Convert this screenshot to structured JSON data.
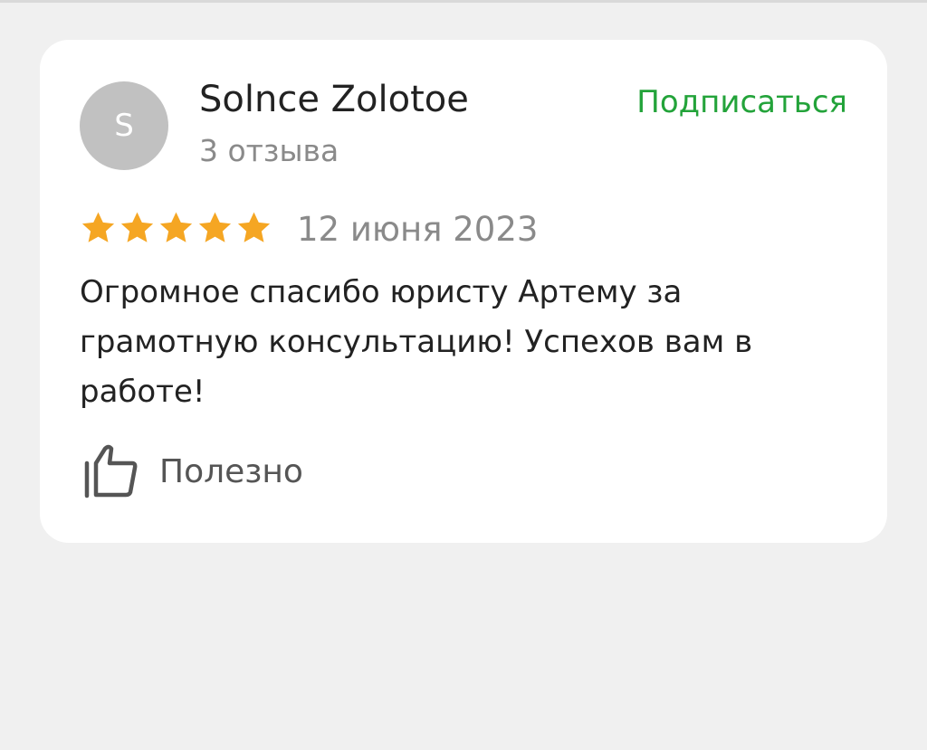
{
  "review": {
    "author": {
      "initial": "S",
      "name": "Solnce Zolotoe",
      "review_count": "3 отзыва"
    },
    "subscribe_label": "Подписаться",
    "rating": 5,
    "date": "12 июня 2023",
    "text": "Огромное спасибо юристу Артему за грамотную консультацию! Успехов вам в работе!",
    "helpful_label": "Полезно",
    "helpful_icon": "thumbs-up-icon"
  },
  "colors": {
    "background": "#f0f0f0",
    "card": "#ffffff",
    "accent_green": "#23a33a",
    "star": "#f5a623",
    "avatar": "#c1c1c1"
  }
}
